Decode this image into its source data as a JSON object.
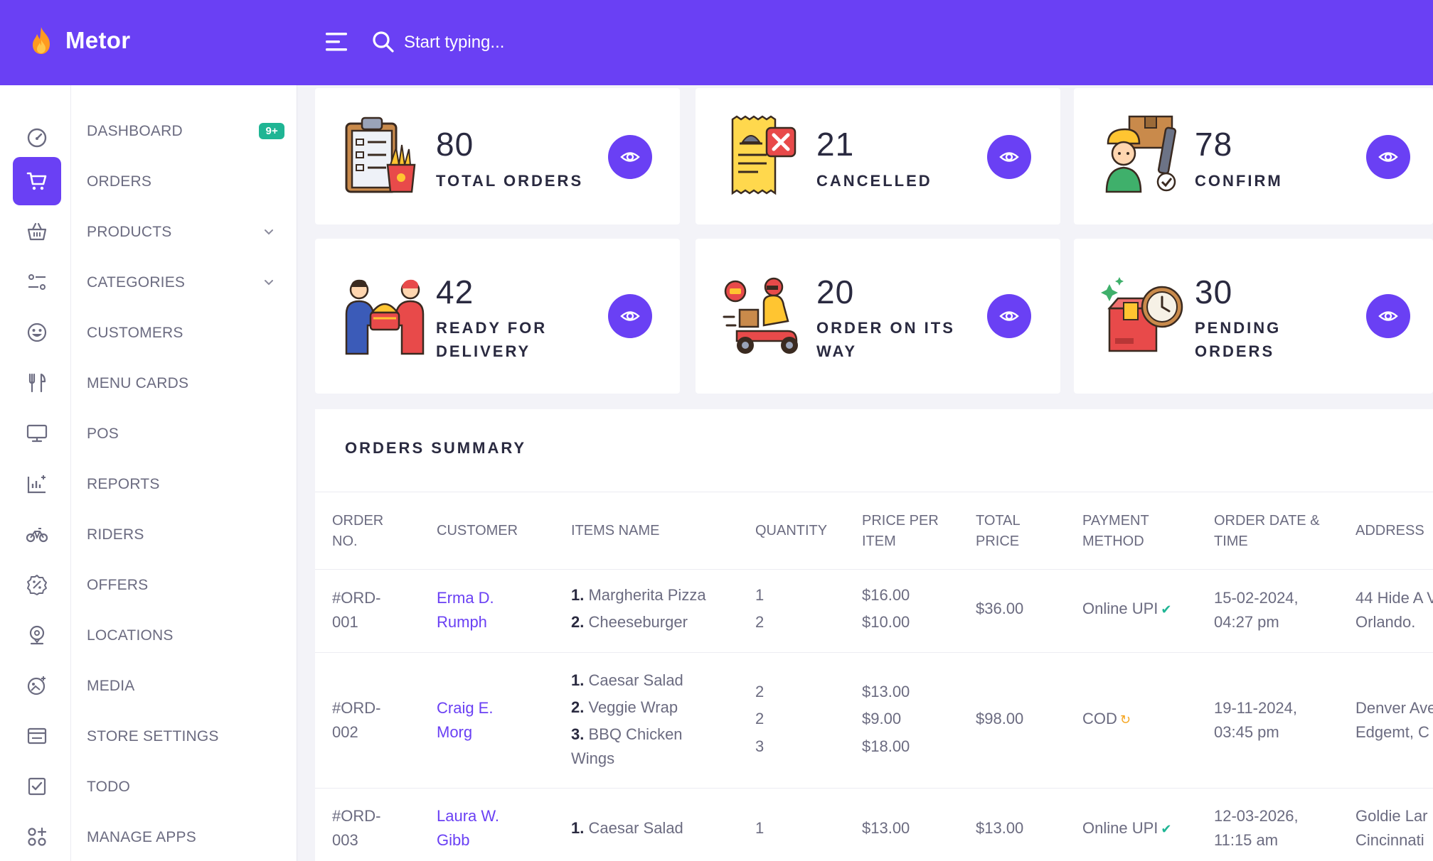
{
  "header": {
    "brand": "Metor",
    "search_placeholder": "Start typing..."
  },
  "sidebar": {
    "items": [
      {
        "label": "DASHBOARD",
        "icon": "gauge-icon",
        "badge": "9+"
      },
      {
        "label": "ORDERS",
        "icon": "cart-icon",
        "active": true
      },
      {
        "label": "PRODUCTS",
        "icon": "basket-icon",
        "has_children": true
      },
      {
        "label": "CATEGORIES",
        "icon": "sliders-icon",
        "has_children": true
      },
      {
        "label": "CUSTOMERS",
        "icon": "smile-icon"
      },
      {
        "label": "MENU CARDS",
        "icon": "fork-knife-icon"
      },
      {
        "label": "POS",
        "icon": "monitor-icon"
      },
      {
        "label": "REPORTS",
        "icon": "chart-icon"
      },
      {
        "label": "RIDERS",
        "icon": "bike-icon"
      },
      {
        "label": "OFFERS",
        "icon": "discount-icon"
      },
      {
        "label": "LOCATIONS",
        "icon": "pin-icon"
      },
      {
        "label": "MEDIA",
        "icon": "image-icon"
      },
      {
        "label": "STORE SETTINGS",
        "icon": "store-icon"
      },
      {
        "label": "TODO",
        "icon": "checkbox-icon"
      },
      {
        "label": "MANAGE APPS",
        "icon": "apps-icon"
      }
    ]
  },
  "stats": [
    {
      "value": "80",
      "label": "TOTAL ORDERS",
      "icon": "clipboard-fries-icon"
    },
    {
      "value": "21",
      "label": "CANCELLED",
      "icon": "receipt-cancel-icon"
    },
    {
      "value": "78",
      "label": "CONFIRM",
      "icon": "delivery-person-icon"
    },
    {
      "value": "42",
      "label": "READY FOR DELIVERY",
      "icon": "handover-icon"
    },
    {
      "value": "20",
      "label": "ORDER ON ITS WAY",
      "icon": "scooter-icon"
    },
    {
      "value": "30",
      "label": "PENDING ORDERS",
      "icon": "box-clock-icon"
    }
  ],
  "summary": {
    "title": "ORDERS SUMMARY",
    "columns": [
      "ORDER NO.",
      "CUSTOMER",
      "ITEMS NAME",
      "QUANTITY",
      "PRICE PER ITEM",
      "TOTAL PRICE",
      "PAYMENT METHOD",
      "ORDER DATE & TIME",
      "ADDRESS"
    ],
    "rows": [
      {
        "order_no": "#ORD-001",
        "customer": "Erma D. Rumph",
        "items": [
          "Margherita Pizza",
          "Cheeseburger"
        ],
        "quantities": [
          "1",
          "2"
        ],
        "prices": [
          "$16.00",
          "$10.00"
        ],
        "total": "$36.00",
        "payment": "Online UPI",
        "payment_status": "done",
        "date": "15-02-2024,",
        "time": "04:27 pm",
        "address_line1": "44 Hide A V",
        "address_line2": "Orlando."
      },
      {
        "order_no": "#ORD-002",
        "customer": "Craig E. Morg",
        "items": [
          "Caesar Salad",
          "Veggie Wrap",
          "BBQ Chicken Wings"
        ],
        "quantities": [
          "2",
          "2",
          "3"
        ],
        "prices": [
          "$13.00",
          "$9.00",
          "$18.00"
        ],
        "total": "$98.00",
        "payment": "COD",
        "payment_status": "pending",
        "date": "19-11-2024,",
        "time": "03:45 pm",
        "address_line1": "Denver Ave",
        "address_line2": "Edgemt, C"
      },
      {
        "order_no": "#ORD-003",
        "customer": "Laura W. Gibb",
        "items": [
          "Caesar Salad"
        ],
        "quantities": [
          "1"
        ],
        "prices": [
          "$13.00"
        ],
        "total": "$13.00",
        "payment": "Online UPI",
        "payment_status": "done",
        "date": "12-03-2026,",
        "time": "11:15 am",
        "address_line1": "Goldie Lar",
        "address_line2": "Cincinnati"
      }
    ]
  },
  "colors": {
    "primary": "#6a40f4",
    "badge": "#1fb594",
    "success": "#1fb594",
    "pending": "#f5a623"
  }
}
